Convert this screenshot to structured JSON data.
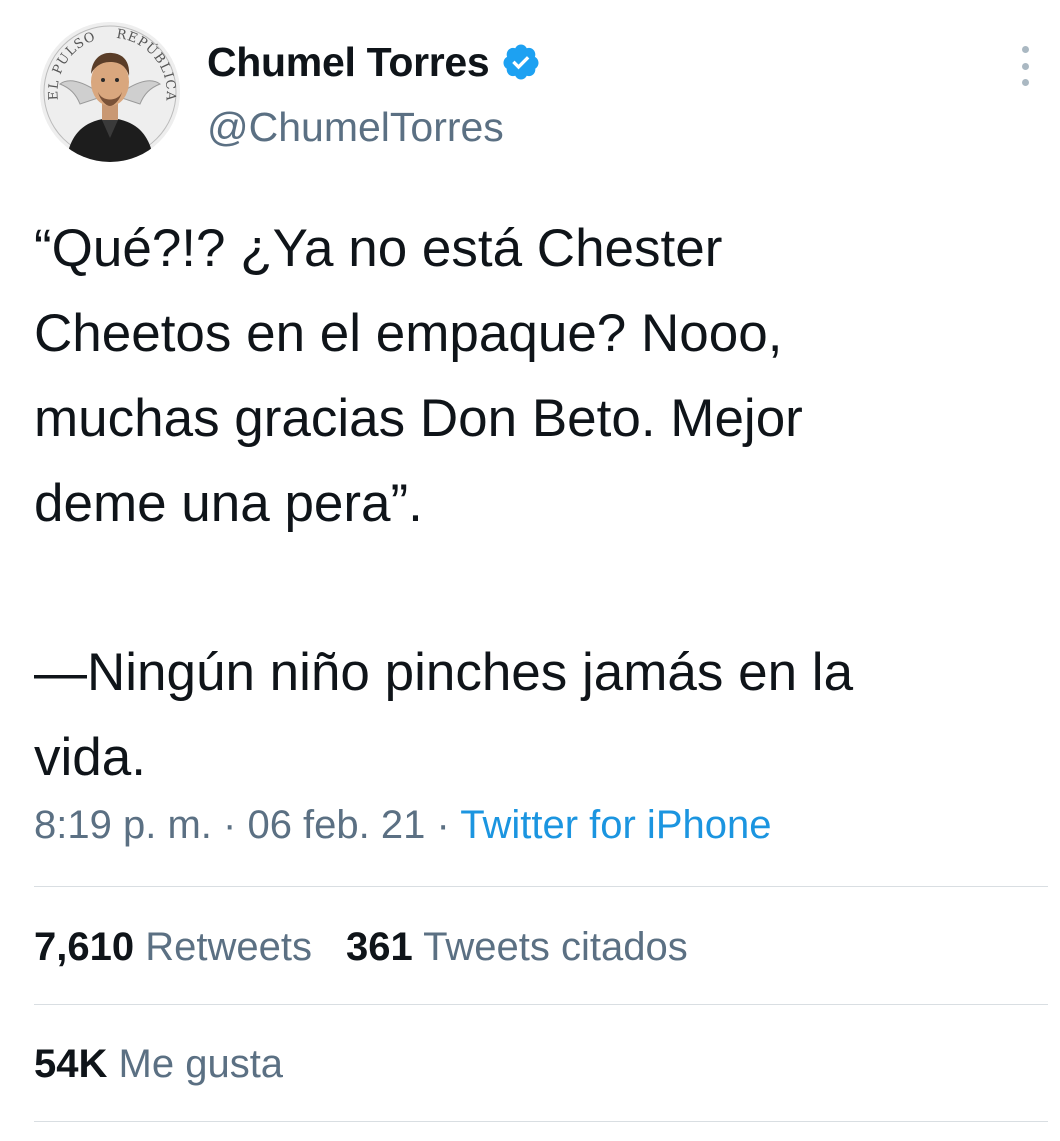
{
  "author": {
    "display_name": "Chumel Torres",
    "handle": "@ChumelTorres",
    "verified": true,
    "avatar_text": {
      "left": "EL PULSO",
      "right": "REPÚBLICA"
    }
  },
  "tweet": {
    "paragraph_1": "“Qué?!? ¿Ya no está Chester\nCheetos en el empaque? Nooo,\nmuchas gracias Don Beto. Mejor\ndeme una pera”.",
    "paragraph_2": "—Ningún niño pinches jamás en la\nvida."
  },
  "meta": {
    "time": "8:19 p. m.",
    "separator": "·",
    "date": "06 feb. 21",
    "source": "Twitter for iPhone"
  },
  "stats": {
    "retweets_count": "7,610",
    "retweets_label": "Retweets",
    "quotes_count": "361",
    "quotes_label": "Tweets citados",
    "likes_count": "54K",
    "likes_label": "Me gusta"
  },
  "colors": {
    "text_primary": "#0f1419",
    "text_secondary": "#5b7083",
    "link": "#1b95e0",
    "verified_badge": "#1da1f2",
    "divider": "#d9dee2"
  },
  "icons": {
    "verified": "verified-badge-icon",
    "more": "more-options-icon"
  }
}
